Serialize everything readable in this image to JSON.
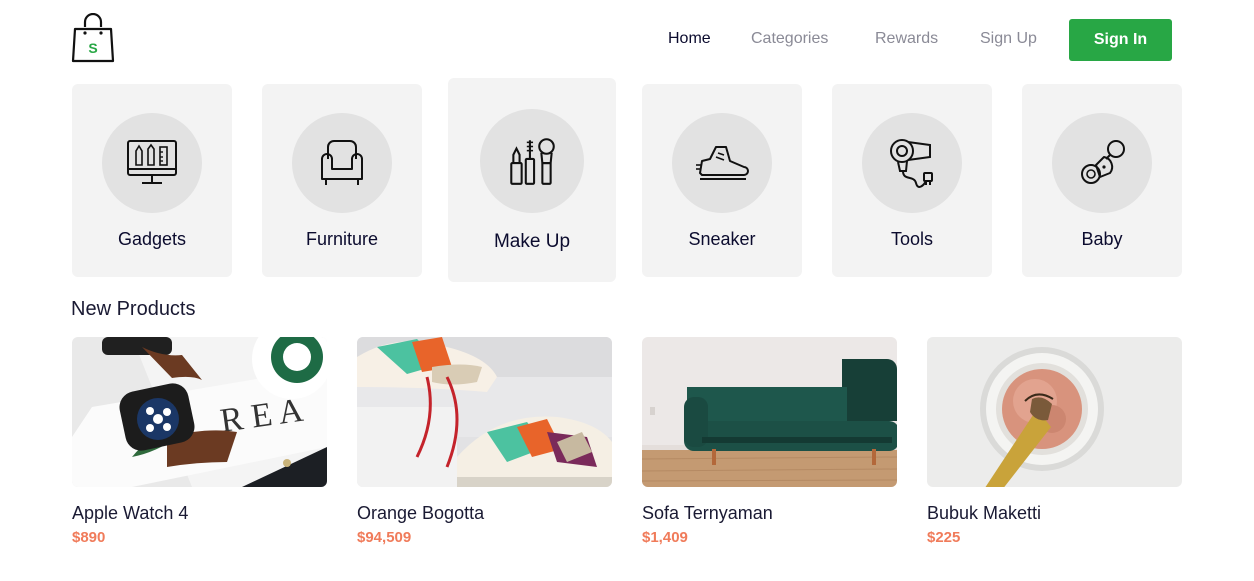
{
  "brand": {
    "logo_letter": "S",
    "logo_color": "#28a745"
  },
  "nav": {
    "items": [
      {
        "label": "Home",
        "active": true
      },
      {
        "label": "Categories",
        "active": false
      },
      {
        "label": "Rewards",
        "active": false
      },
      {
        "label": "Sign Up",
        "active": false
      }
    ],
    "signin_label": "Sign In"
  },
  "categories": [
    {
      "label": "Gadgets",
      "icon": "monitor-design-icon"
    },
    {
      "label": "Furniture",
      "icon": "armchair-icon"
    },
    {
      "label": "Make Up",
      "icon": "makeup-icon"
    },
    {
      "label": "Sneaker",
      "icon": "sneaker-icon"
    },
    {
      "label": "Tools",
      "icon": "hair-dryer-icon"
    },
    {
      "label": "Baby",
      "icon": "pacifier-icon"
    }
  ],
  "new_products": {
    "title": "New Products",
    "items": [
      {
        "name": "Apple Watch 4",
        "price": "$890",
        "image": "smartwatch-photo"
      },
      {
        "name": "Orange Bogotta",
        "price": "$94,509",
        "image": "sneakers-photo"
      },
      {
        "name": "Sofa Ternyaman",
        "price": "$1,409",
        "image": "green-sofa-photo"
      },
      {
        "name": "Bubuk Maketti",
        "price": "$225",
        "image": "makeup-powder-photo"
      }
    ]
  },
  "colors": {
    "accent": "#28a745",
    "price": "#f07b5a",
    "card_bg": "#f3f3f3",
    "circle_bg": "#e2e2e2"
  }
}
